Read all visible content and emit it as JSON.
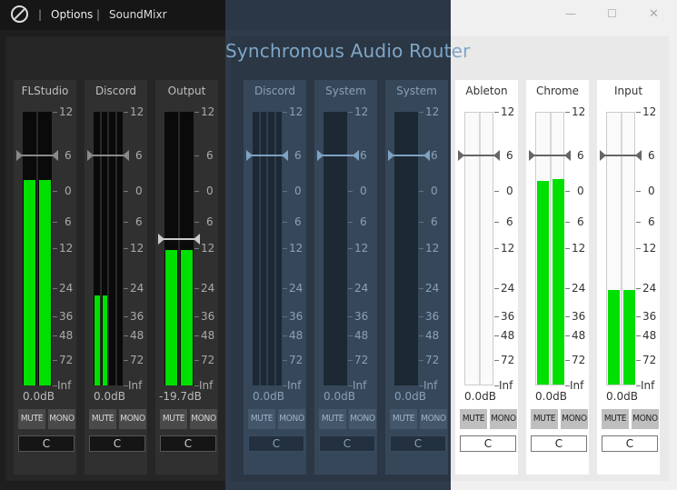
{
  "titlebar": {
    "options_label": "Options",
    "app_name": "SoundMixr",
    "separator": "|",
    "minimize_glyph": "—",
    "maximize_glyph": "☐",
    "close_glyph": "✕"
  },
  "overlay_title": "Synchronous Audio Router",
  "scale": [
    "12",
    "6",
    "0",
    "6",
    "12",
    "24",
    "36",
    "48",
    "72",
    "Inf"
  ],
  "buttons": {
    "mute": "MUTE",
    "mono": "MONO"
  },
  "channels": [
    {
      "name": "FLStudio",
      "theme": "dark",
      "meters": 2,
      "levels_db": [
        -4.2,
        -4.2
      ],
      "fader_db": 0,
      "volume": "0.0dB",
      "pan": "C"
    },
    {
      "name": "Discord",
      "theme": "dark",
      "meters": 4,
      "levels_db": [
        -39,
        -39,
        -99,
        -99
      ],
      "fader_db": 0,
      "volume": "0.0dB",
      "pan": "C"
    },
    {
      "name": "Output",
      "theme": "dark",
      "meters": 2,
      "levels_db": [
        -24.5,
        -24.5
      ],
      "fader_db": -19.7,
      "volume": "-19.7dB",
      "pan": "C"
    },
    {
      "name": "Discord",
      "theme": "blue",
      "meters": 4,
      "levels_db": [
        -99,
        -99,
        -99,
        -99
      ],
      "fader_db": 0,
      "volume": "0.0dB",
      "pan": "C"
    },
    {
      "name": "System",
      "theme": "blue",
      "meters": 1,
      "levels_db": [
        -99
      ],
      "fader_db": 0,
      "volume": "0.0dB",
      "pan": "C"
    },
    {
      "name": "System",
      "theme": "blue",
      "meters": 1,
      "levels_db": [
        -99
      ],
      "fader_db": 0,
      "volume": "0.0dB",
      "pan": "C"
    },
    {
      "name": "Ableton",
      "theme": "light",
      "meters": 2,
      "levels_db": [
        -99,
        -99
      ],
      "fader_db": 0,
      "volume": "0.0dB",
      "pan": "C"
    },
    {
      "name": "Chrome",
      "theme": "light",
      "meters": 2,
      "levels_db": [
        -4.5,
        -4.2
      ],
      "fader_db": 0,
      "volume": "0.0dB",
      "pan": "C"
    },
    {
      "name": "Input",
      "theme": "light",
      "meters": 2,
      "levels_db": [
        -37,
        -37
      ],
      "fader_db": 0,
      "volume": "0.0dB",
      "pan": "C"
    }
  ],
  "colors": {
    "meter_fill": "#00e000",
    "accent_blue": "#7fa6c6"
  }
}
